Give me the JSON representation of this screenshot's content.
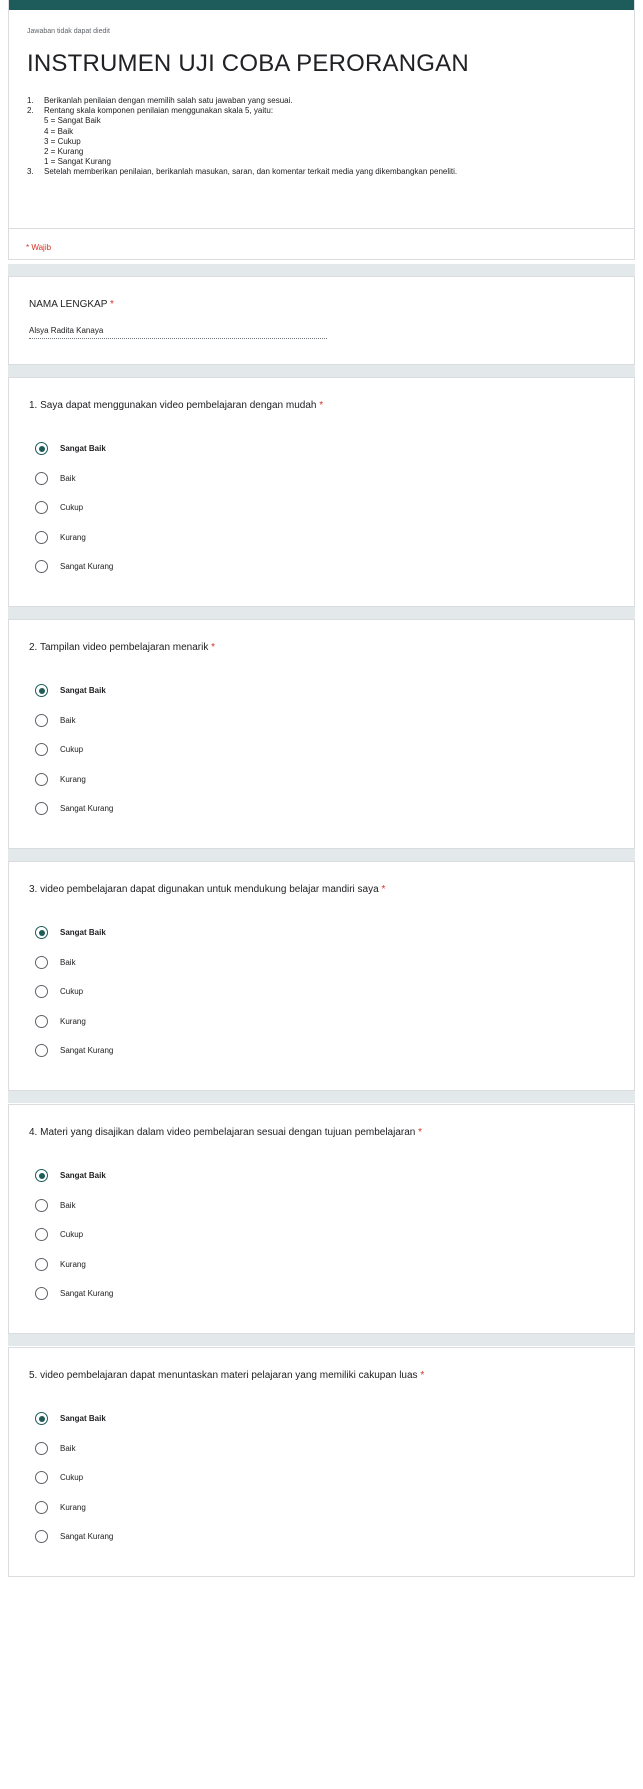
{
  "header": {
    "note": "Jawaban tidak dapat diedit",
    "title": "INSTRUMEN UJI COBA PERORANGAN",
    "instructions": {
      "i1_num": "1.",
      "i1": "Berikanlah penilaian dengan memilih salah satu jawaban yang sesuai.",
      "i2_num": "2.",
      "i2": "Rentang skala komponen penilaian menggunakan skala 5, yaitu:",
      "scale": [
        "5  = Sangat Baik",
        "4  = Baik",
        "3  = Cukup",
        "2  = Kurang",
        "1  = Sangat Kurang"
      ],
      "i3_num": "3.",
      "i3": "Setelah memberikan penilaian, berikanlah masukan, saran, dan komentar terkait media yang dikembangkan peneliti."
    },
    "required_note": "* Wajib"
  },
  "name_field": {
    "label": "NAMA LENGKAP",
    "required_mark": "*",
    "value": "Alsya Radita Kanaya"
  },
  "options": [
    "Sangat Baik",
    "Baik",
    "Cukup",
    "Kurang",
    "Sangat Kurang"
  ],
  "questions": [
    {
      "label": "1. Saya dapat menggunakan video pembelajaran dengan mudah",
      "required_mark": "*",
      "selected": "Sangat Baik"
    },
    {
      "label": "2. Tampilan video pembelajaran menarik",
      "required_mark": "*",
      "selected": "Sangat Baik"
    },
    {
      "label": "3. video pembelajaran dapat digunakan untuk mendukung belajar mandiri saya",
      "required_mark": "*",
      "selected": "Sangat Baik"
    },
    {
      "label": "4. Materi yang disajikan dalam video pembelajaran sesuai dengan tujuan pembelajaran",
      "required_mark": "*",
      "selected": "Sangat Baik"
    },
    {
      "label": "5. video pembelajaran dapat menuntaskan materi pelajaran yang memiliki cakupan luas",
      "required_mark": "*",
      "selected": "Sangat Baik"
    }
  ],
  "colors": {
    "accent": "#1e5b5b",
    "required": "#d93025",
    "separator": "#e3e8ea"
  }
}
